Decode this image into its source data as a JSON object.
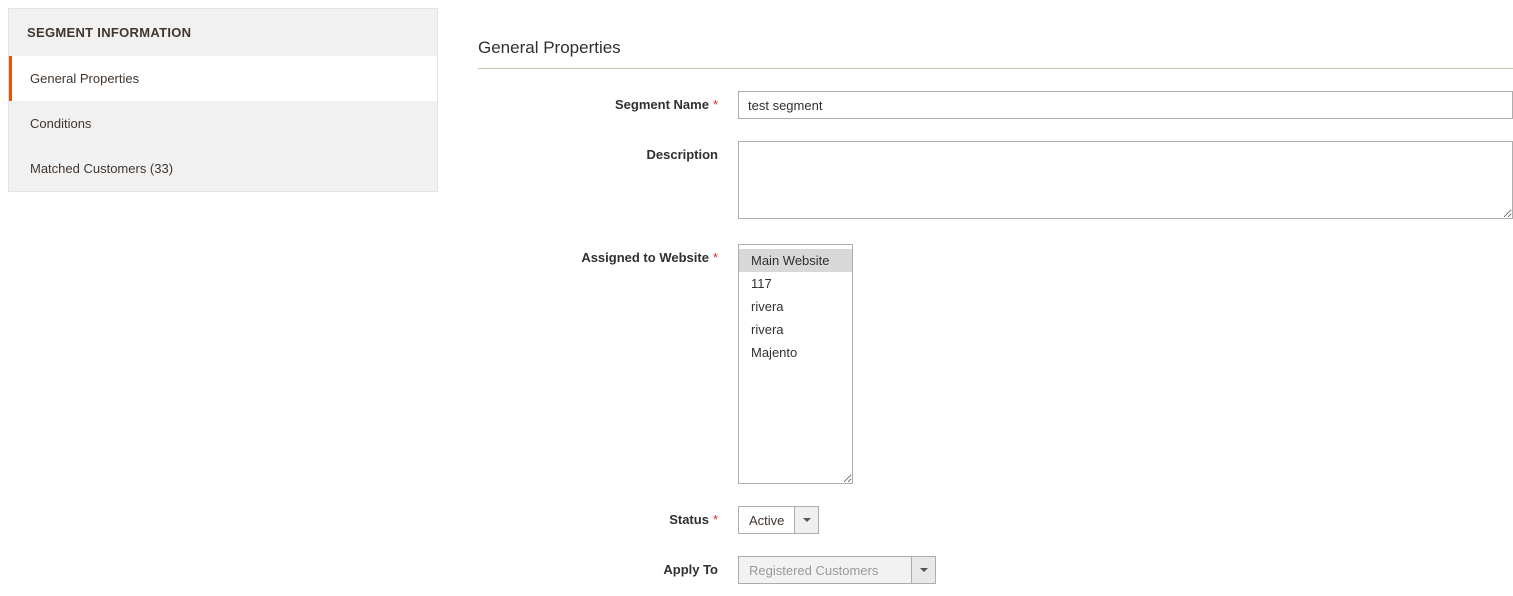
{
  "sidebar": {
    "header": "SEGMENT INFORMATION",
    "items": [
      {
        "label": "General Properties",
        "active": true
      },
      {
        "label": "Conditions",
        "active": false
      },
      {
        "label": "Matched Customers (33)",
        "active": false
      }
    ]
  },
  "main": {
    "title": "General Properties",
    "fields": {
      "segment_name": {
        "label": "Segment Name",
        "required": true,
        "value": "test segment"
      },
      "description": {
        "label": "Description",
        "required": false,
        "value": ""
      },
      "assigned_to_website": {
        "label": "Assigned to Website",
        "required": true,
        "options": [
          {
            "label": "Main Website",
            "selected": true
          },
          {
            "label": "117",
            "selected": false
          },
          {
            "label": "rivera",
            "selected": false
          },
          {
            "label": "rivera",
            "selected": false
          },
          {
            "label": "Majento",
            "selected": false
          }
        ]
      },
      "status": {
        "label": "Status",
        "required": true,
        "value": "Active"
      },
      "apply_to": {
        "label": "Apply To",
        "required": false,
        "value": "Registered Customers",
        "disabled": true
      }
    }
  }
}
